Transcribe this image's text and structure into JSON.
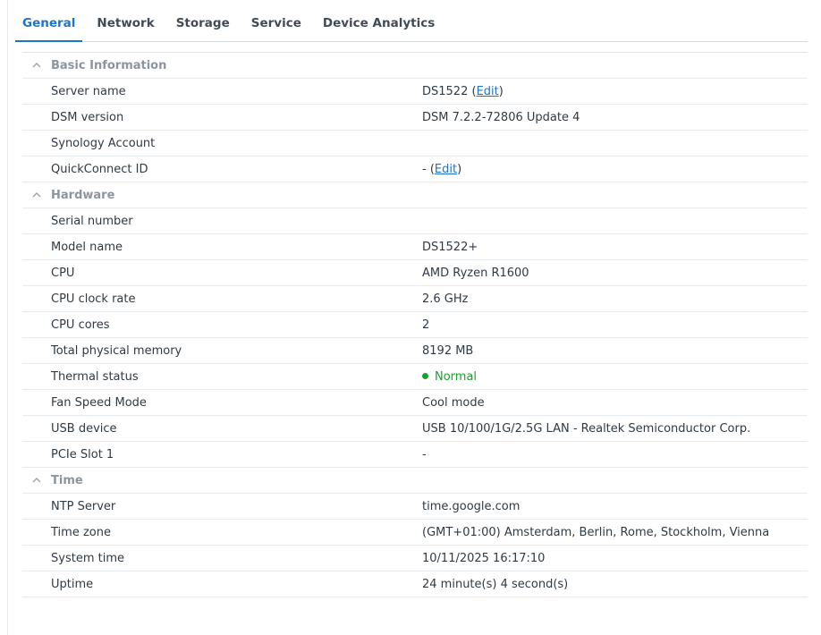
{
  "tabs": [
    {
      "label": "General",
      "active": true
    },
    {
      "label": "Network",
      "active": false
    },
    {
      "label": "Storage",
      "active": false
    },
    {
      "label": "Service",
      "active": false
    },
    {
      "label": "Device Analytics",
      "active": false
    }
  ],
  "sections": {
    "basic": {
      "title": "Basic Information",
      "server_name": {
        "label": "Server name",
        "value": "DS1522",
        "edit": "Edit"
      },
      "dsm_version": {
        "label": "DSM version",
        "value": "DSM 7.2.2-72806 Update 4"
      },
      "synology_account": {
        "label": "Synology Account",
        "value": ""
      },
      "quickconnect": {
        "label": "QuickConnect ID",
        "value": "-",
        "edit": "Edit"
      }
    },
    "hardware": {
      "title": "Hardware",
      "serial": {
        "label": "Serial number",
        "value": ""
      },
      "model": {
        "label": "Model name",
        "value": "DS1522+"
      },
      "cpu": {
        "label": "CPU",
        "value": "AMD Ryzen R1600"
      },
      "cpu_clock": {
        "label": "CPU clock rate",
        "value": "2.6 GHz"
      },
      "cpu_cores": {
        "label": "CPU cores",
        "value": "2"
      },
      "memory": {
        "label": "Total physical memory",
        "value": "8192 MB"
      },
      "thermal": {
        "label": "Thermal status",
        "value": "Normal"
      },
      "fan": {
        "label": "Fan Speed Mode",
        "value": "Cool mode"
      },
      "usb": {
        "label": "USB device",
        "value": "USB 10/100/1G/2.5G LAN - Realtek Semiconductor Corp."
      },
      "pcie": {
        "label": "PCIe Slot 1",
        "value": "-"
      }
    },
    "time": {
      "title": "Time",
      "ntp": {
        "label": "NTP Server",
        "value": "time.google.com"
      },
      "timezone": {
        "label": "Time zone",
        "value": "(GMT+01:00) Amsterdam, Berlin, Rome, Stockholm, Vienna"
      },
      "system_time": {
        "label": "System time",
        "value": "10/11/2025 16:17:10"
      },
      "uptime": {
        "label": "Uptime",
        "value": "24 minute(s) 4 second(s)"
      }
    }
  },
  "colors": {
    "accent": "#1f74c7",
    "status_ok": "#1aa12b",
    "section_title": "#8c959e"
  }
}
